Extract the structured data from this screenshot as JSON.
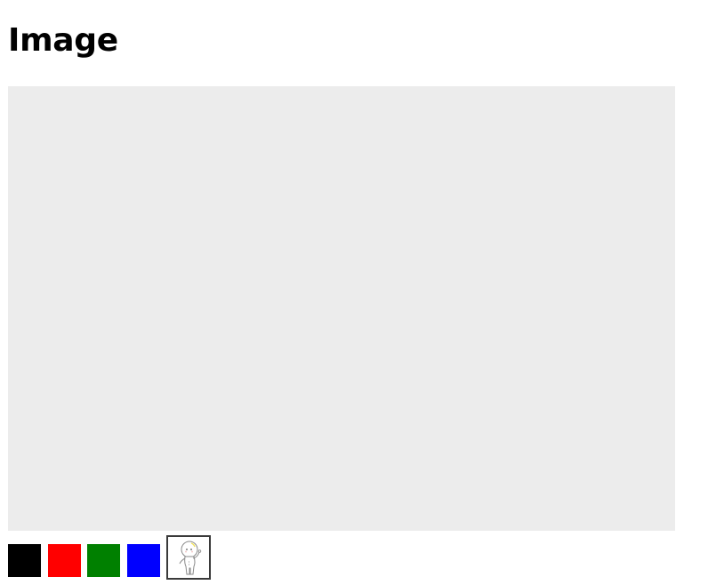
{
  "page": {
    "title": "Image"
  },
  "canvas": {
    "background_color": "#ececec"
  },
  "palette": {
    "swatches": [
      {
        "name": "black",
        "color": "#000000"
      },
      {
        "name": "red",
        "color": "#ff0000"
      },
      {
        "name": "green",
        "color": "#008000"
      },
      {
        "name": "blue",
        "color": "#0000ff"
      }
    ],
    "image_swatch": {
      "icon": "lightbulb-character-icon",
      "selected": true
    }
  }
}
